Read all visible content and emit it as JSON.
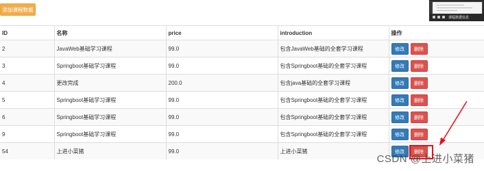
{
  "toolbar": {
    "add_label": "添加课程数据"
  },
  "thumbnail": {
    "caption": "课程数据信息"
  },
  "table": {
    "headers": [
      "ID",
      "名称",
      "price",
      "introduction",
      "操作"
    ],
    "edit_label": "修改",
    "delete_label": "删除",
    "rows": [
      {
        "id": "2",
        "name": "JavaWeb基础学习课程",
        "price": "99.0",
        "intro": "包含JavaWeb基础的全套学习课程"
      },
      {
        "id": "3",
        "name": "Springboot基础学习课程",
        "price": "99.0",
        "intro": "包含Springboot基础的全套学习课程"
      },
      {
        "id": "4",
        "name": "更改完成",
        "price": "200.0",
        "intro": "包含java基础的全套学习课程"
      },
      {
        "id": "5",
        "name": "Springboot基础学习课程",
        "price": "99.0",
        "intro": "包含Springboot基础的全套学习课程"
      },
      {
        "id": "6",
        "name": "Springboot基础学习课程",
        "price": "99.0",
        "intro": "包含Springboot基础的全套学习课程"
      },
      {
        "id": "9",
        "name": "Springboot基础学习课程",
        "price": "99.0",
        "intro": "包含Springboot基础的全套学习课程"
      },
      {
        "id": "54",
        "name": "上进小菜猪",
        "price": "99.0",
        "intro": "上进小菜猪"
      }
    ]
  },
  "watermark": "CSDN @上进小菜猪",
  "colors": {
    "edit": "#337ab7",
    "delete": "#d9534f",
    "add": "#f0ad4e",
    "annotation": "#e8101a"
  }
}
